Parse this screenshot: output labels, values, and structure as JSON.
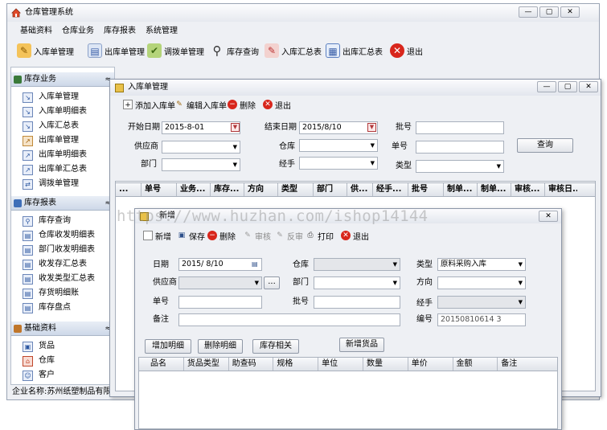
{
  "main_window": {
    "title": "仓库管理系统",
    "controls": [
      "—",
      "▢",
      "✕"
    ],
    "menu": [
      "基础资料",
      "仓库业务",
      "库存报表",
      "系统管理"
    ],
    "toolbar": [
      {
        "label": "入库单管理",
        "icon": "inbound-doc-icon"
      },
      {
        "label": "出库单管理",
        "icon": "outbound-doc-icon"
      },
      {
        "label": "调拨单管理",
        "icon": "transfer-icon"
      },
      {
        "label": "库存查询",
        "icon": "magnifier-icon"
      },
      {
        "label": "入库汇总表",
        "icon": "inbound-summary-icon"
      },
      {
        "label": "出库汇总表",
        "icon": "calendar-grid-icon"
      },
      {
        "label": "退出",
        "icon": "exit-icon"
      }
    ],
    "status": "企业名称:苏州纸塑制品有限公司"
  },
  "sidebar": {
    "sections": [
      {
        "title": "库存业务",
        "items": [
          "入库单管理",
          "入库单明细表",
          "入库汇总表",
          "出库单管理",
          "出库单明细表",
          "出库单汇总表",
          "调拨单管理"
        ]
      },
      {
        "title": "库存报表",
        "items": [
          "库存查询",
          "仓库收发明细表",
          "部门收发明细表",
          "收发存汇总表",
          "收发类型汇总表",
          "存货明细账",
          "库存盘点"
        ]
      },
      {
        "title": "基础资料",
        "items": [
          "货品",
          "仓库",
          "客户"
        ]
      }
    ],
    "chevron": "≈"
  },
  "inbound_window": {
    "title": "入库单管理",
    "toolbar": [
      "添加入库单",
      "编辑入库单",
      "删除",
      "退出"
    ],
    "labels": {
      "start_date": "开始日期",
      "end_date": "结束日期",
      "doc_no": "批号",
      "supplier": "供应商",
      "warehouse": "仓库",
      "number": "单号",
      "dept": "部门",
      "handler": "经手",
      "type": "类型"
    },
    "values": {
      "start_date": "2015-8-01",
      "end_date": "2015/8/10"
    },
    "query_button": "查询",
    "grid_headers": [
      "...",
      "单号",
      "业务...",
      "库存...",
      "方向",
      "类型",
      "部门",
      "供...",
      "经手...",
      "批号",
      "制单...",
      "制单...",
      "审核...",
      "审核日..."
    ]
  },
  "new_window": {
    "title": "新增",
    "toolbar": [
      {
        "label": "新增",
        "enabled": true
      },
      {
        "label": "保存",
        "enabled": true
      },
      {
        "label": "删除",
        "enabled": true
      },
      {
        "label": "审核",
        "enabled": false
      },
      {
        "label": "反审",
        "enabled": false
      },
      {
        "label": "打印",
        "enabled": true
      },
      {
        "label": "退出",
        "enabled": true
      }
    ],
    "labels": {
      "date": "日期",
      "warehouse": "仓库",
      "type": "类型",
      "supplier": "供应商",
      "dept": "部门",
      "direction": "方向",
      "number": "单号",
      "batch": "批号",
      "handler": "经手",
      "remark": "备注",
      "code": "编号"
    },
    "values": {
      "date": "2015/ 8/10",
      "type": "原料采购入库",
      "code": "20150810614 3",
      "ellipsis": "..."
    },
    "buttons": [
      "增加明细",
      "删除明细",
      "库存相关",
      "新增货品"
    ],
    "grid_headers": [
      "品名",
      "货品类型",
      "助查码",
      "规格",
      "单位",
      "数量",
      "单价",
      "金额",
      "备注"
    ]
  },
  "watermark": "https://www.huzhan.com/ishop14144"
}
